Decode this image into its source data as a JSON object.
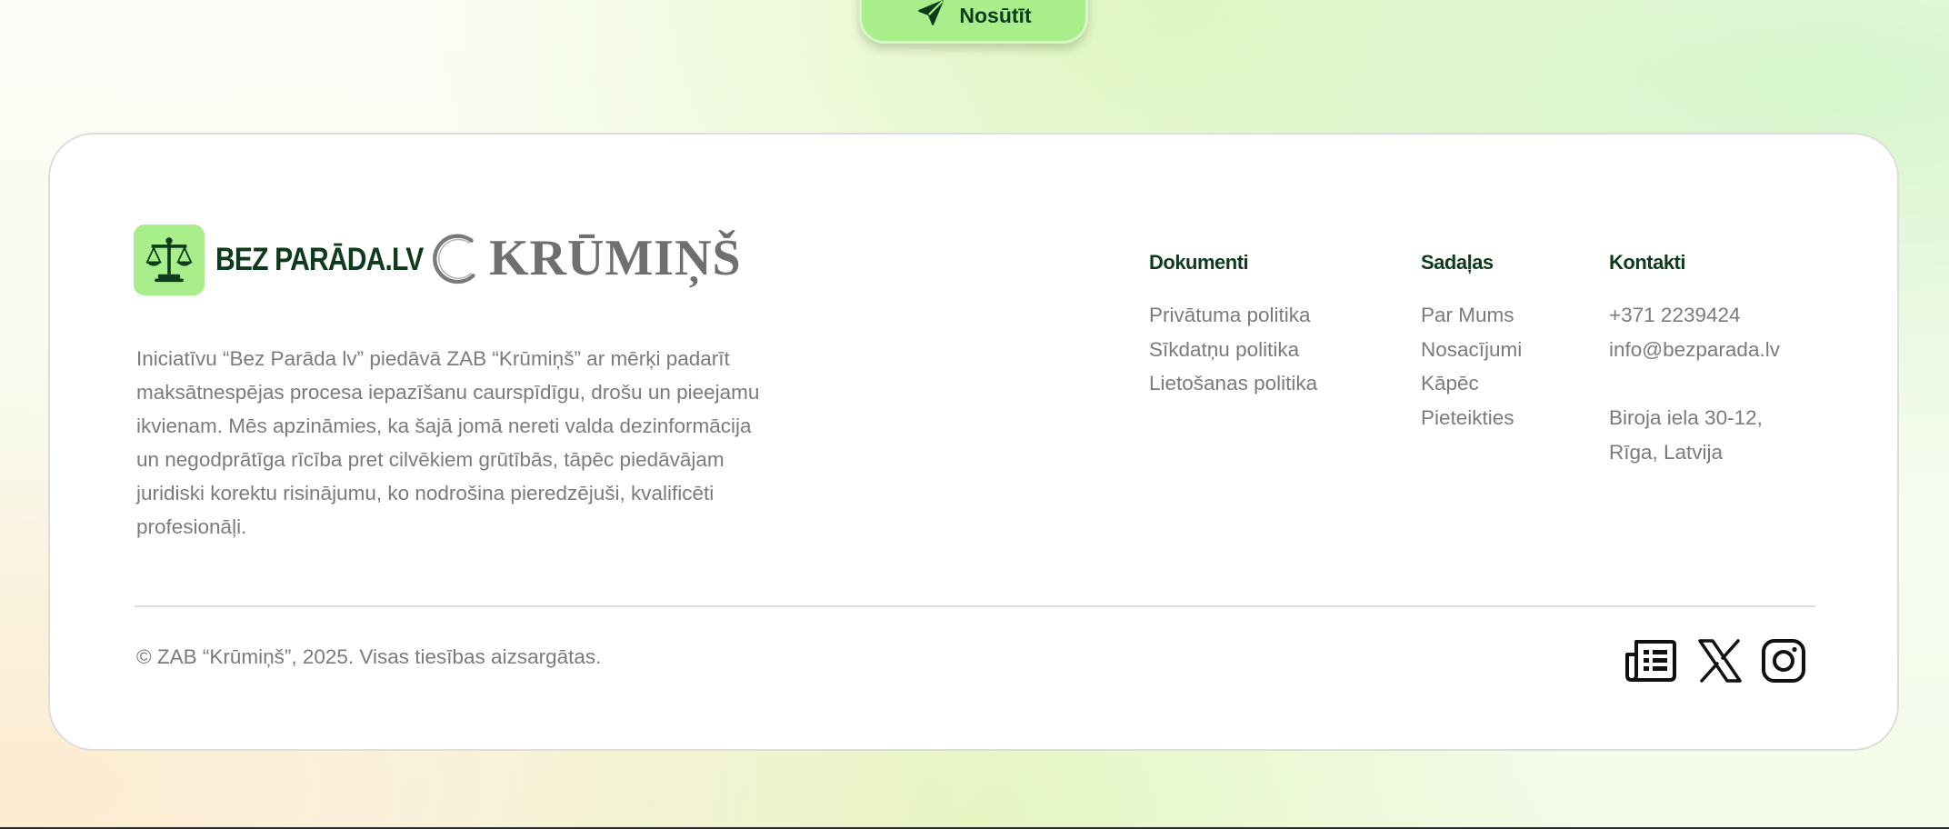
{
  "send_button": {
    "label": "Nosūtīt",
    "icon": "send-icon"
  },
  "brand": {
    "name": "BEZ PARĀDA.LV",
    "badge_icon": "scales-icon",
    "badge_color": "#a8ef8c",
    "text_color": "#0d3b1c"
  },
  "partner": {
    "name": "KRŪMIŅŠ"
  },
  "description": "Iniciatīvu “Bez Parāda lv” piedāvā ZAB “Krūmiņš” ar mērķi padarīt maksātnespējas procesa iepazīšanu  caurspīdīgu, drošu un pieejamu ikvienam. Mēs apzināmies, ka šajā jomā nereti valda dezinformācija un negodprātīga rīcība pret cilvēkiem grūtībās, tāpēc piedāvājam juridiski korektu risinājumu, ko nodrošina pieredzējuši, kvalificēti profesionāļi.",
  "columns": {
    "documents": {
      "title": "Dokumenti",
      "links": [
        "Privātuma politika",
        "Sīkdatņu politika",
        "Lietošanas politika"
      ]
    },
    "sections": {
      "title": "Sadaļas",
      "links": [
        "Par Mums",
        "Nosacījumi",
        "Kāpēc",
        "Pieteikties"
      ]
    },
    "contacts": {
      "title": "Kontakti",
      "phone": "+371 2239424",
      "email": "info@bezparada.lv",
      "address": [
        "Biroja iela 30-12,",
        "Rīga, Latvija"
      ]
    }
  },
  "copyright": "© ZAB “Krūmiņš”, 2025. Visas tiesības aizsargātas.",
  "social": [
    "news-icon",
    "x-icon",
    "instagram-icon"
  ]
}
